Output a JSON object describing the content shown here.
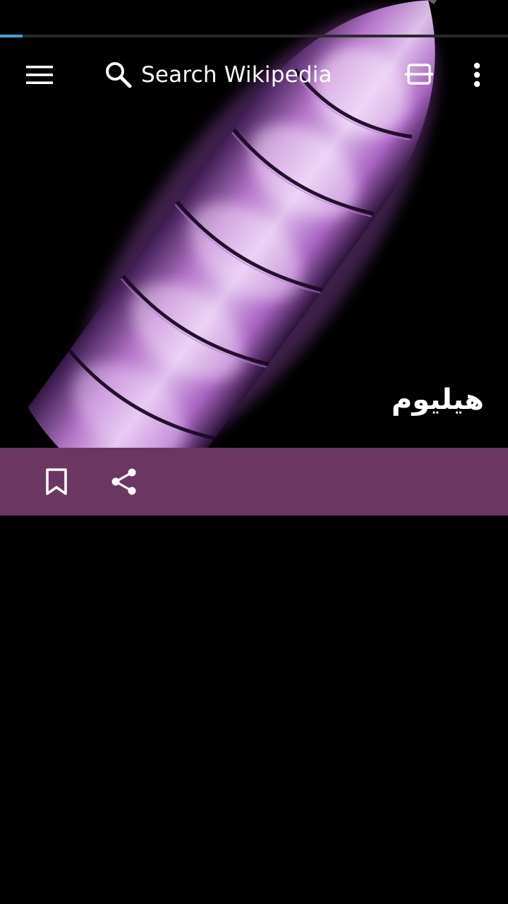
{
  "progress": {
    "value": 0.044,
    "color": "#3ea6d6"
  },
  "toolbar": {
    "menu_icon": "menu-icon",
    "search_icon": "search-icon",
    "search_label": "Search Wikipedia",
    "tabs_icon": "tabs-icon",
    "overflow_icon": "more-vert-icon"
  },
  "article": {
    "title": "هيليوم",
    "lead_image": "glowing-helium-gas-discharge-tube"
  },
  "action_bar": {
    "color": "#6b3662",
    "save_icon": "bookmark-icon",
    "share_icon": "share-icon"
  }
}
